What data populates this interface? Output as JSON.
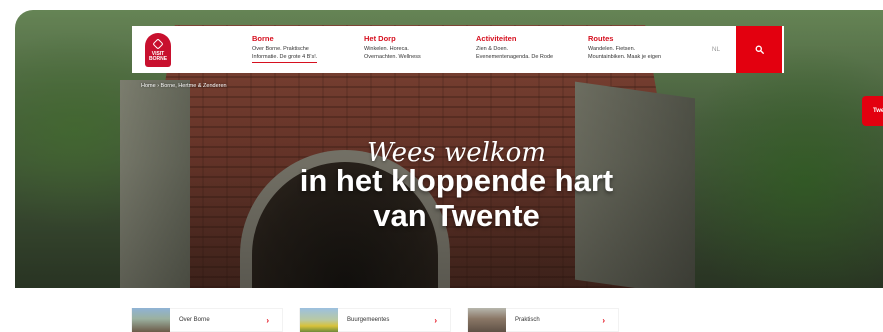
{
  "header": {
    "logo_text": "VISIT BORNE",
    "nav": [
      {
        "title": "Borne",
        "desc": "Over Borne. Praktische\nInformatie. De grote 4 B's!."
      },
      {
        "title": "Het Dorp",
        "desc": "Winkelen. Horeca.\nOvernachten. Wellness"
      },
      {
        "title": "Activiteiten",
        "desc": "Zien & Doen.\nEvenementenagenda. De Rode"
      },
      {
        "title": "Routes",
        "desc": "Wandelen. Fietsen.\nMountainbiken. Maak je eigen"
      }
    ],
    "language": "NL"
  },
  "breadcrumb": "Home › Borne, Hertme & Zenderen",
  "hero": {
    "welcome": "Wees welkom",
    "title_line1": "in het kloppende hart",
    "title_line2": "van Twente"
  },
  "side_tab": "Twe",
  "quick_links": [
    {
      "label": "Over Borne"
    },
    {
      "label": "Buurgemeentes"
    },
    {
      "label": "Praktisch"
    }
  ],
  "colors": {
    "brand_red": "#e3000f",
    "nav_title_red": "#d6101f"
  }
}
